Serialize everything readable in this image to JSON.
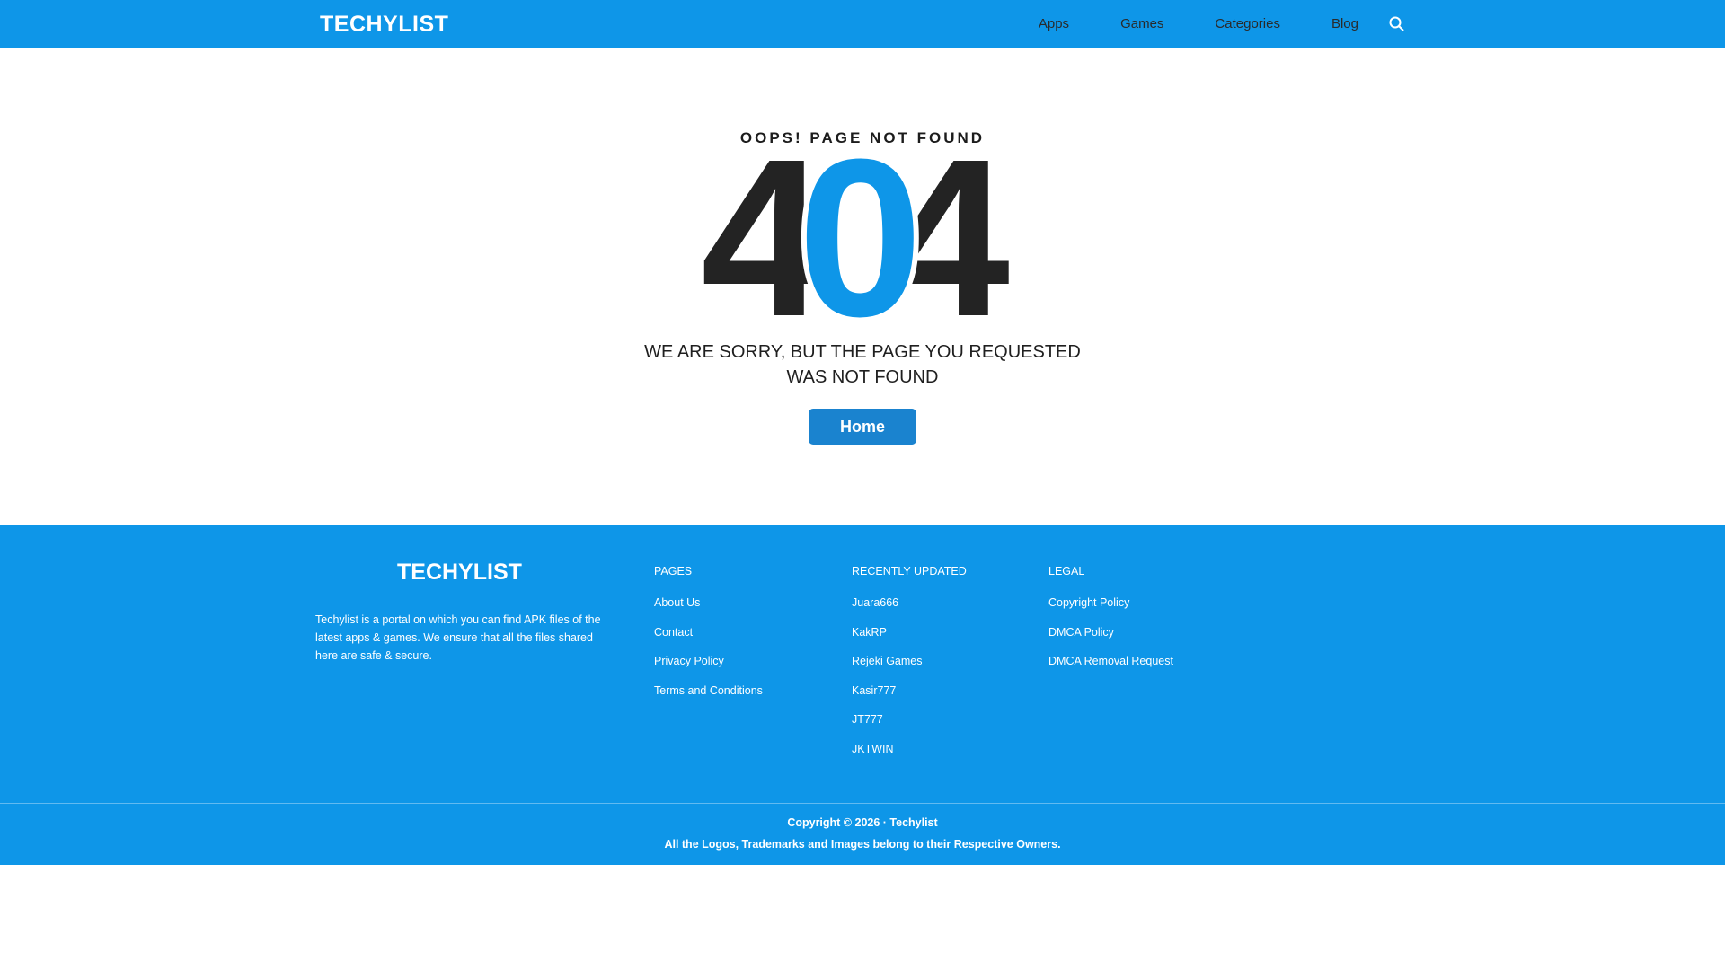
{
  "header": {
    "logo": "TECHYLIST",
    "nav": [
      "Apps",
      "Games",
      "Categories",
      "Blog"
    ],
    "search_icon": "search-icon"
  },
  "error": {
    "kicker": "OOPS! PAGE NOT FOUND",
    "digits": [
      "4",
      "0",
      "4"
    ],
    "message": "WE ARE SORRY, BUT THE PAGE YOU REQUESTED WAS NOT FOUND",
    "home_button": "Home"
  },
  "footer": {
    "logo": "TECHYLIST",
    "about": "Techylist is a portal on which you can find APK files of the latest apps & games. We ensure that all the files shared here are safe & secure.",
    "pages": {
      "title": "PAGES",
      "items": [
        "About Us",
        "Contact",
        "Privacy Policy",
        "Terms and Conditions"
      ]
    },
    "recent": {
      "title": "RECENTLY UPDATED",
      "items": [
        "Juara666",
        "KakRP",
        "Rejeki Games",
        "Kasir777",
        "JT777",
        "JKTWIN"
      ]
    },
    "legal": {
      "title": "LEGAL",
      "items": [
        "Copyright Policy",
        "DMCA Policy",
        "DMCA Removal Request"
      ]
    },
    "copyright": "Copyright © 2026 · Techylist",
    "trademark": "All the Logos, Trademarks and Images belong to their Respective Owners."
  },
  "colors": {
    "brand_blue": "#0e96e8",
    "button_blue": "#1a83cf",
    "dark_text": "#232323"
  }
}
